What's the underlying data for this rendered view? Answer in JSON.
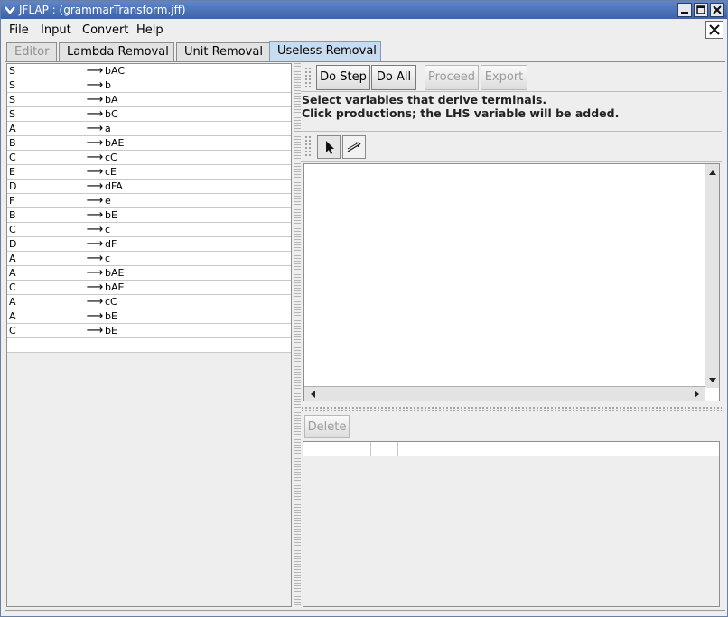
{
  "window": {
    "title": "JFLAP : (grammarTransform.jff)"
  },
  "menu": [
    "File",
    "Input",
    "Convert",
    "Help"
  ],
  "tabs": [
    {
      "label": "Editor",
      "state": "disabled"
    },
    {
      "label": "Lambda Removal",
      "state": "normal"
    },
    {
      "label": "Unit Removal",
      "state": "normal"
    },
    {
      "label": "Useless Removal",
      "state": "active"
    }
  ],
  "grammar": {
    "arrow": "⟶",
    "rows": [
      {
        "lhs": "S",
        "rhs": "bAC"
      },
      {
        "lhs": "S",
        "rhs": "b"
      },
      {
        "lhs": "S",
        "rhs": "bA"
      },
      {
        "lhs": "S",
        "rhs": "bC"
      },
      {
        "lhs": "A",
        "rhs": "a"
      },
      {
        "lhs": "B",
        "rhs": "bAE"
      },
      {
        "lhs": "C",
        "rhs": "cC"
      },
      {
        "lhs": "E",
        "rhs": "cE"
      },
      {
        "lhs": "D",
        "rhs": "dFA"
      },
      {
        "lhs": "F",
        "rhs": "e"
      },
      {
        "lhs": "B",
        "rhs": "bE"
      },
      {
        "lhs": "C",
        "rhs": "c"
      },
      {
        "lhs": "D",
        "rhs": "dF"
      },
      {
        "lhs": "A",
        "rhs": "c"
      },
      {
        "lhs": "A",
        "rhs": "bAE"
      },
      {
        "lhs": "C",
        "rhs": "bAE"
      },
      {
        "lhs": "A",
        "rhs": "cC"
      },
      {
        "lhs": "A",
        "rhs": "bE"
      },
      {
        "lhs": "C",
        "rhs": "bE"
      }
    ]
  },
  "controls": {
    "do_step": "Do Step",
    "do_all": "Do All",
    "proceed": "Proceed",
    "export": "Export",
    "delete": "Delete"
  },
  "instructions": {
    "line1": "Select variables that derive terminals.",
    "line2": "Click productions; the LHS variable will be added."
  },
  "icons": {
    "app": "jflap-menu-icon",
    "arrow_tool": "pointer-arrow-icon",
    "edge_tool": "transition-arrow-icon"
  },
  "colors": {
    "titlebar": "#4a71b8",
    "active_tab": "#c9dbef"
  }
}
